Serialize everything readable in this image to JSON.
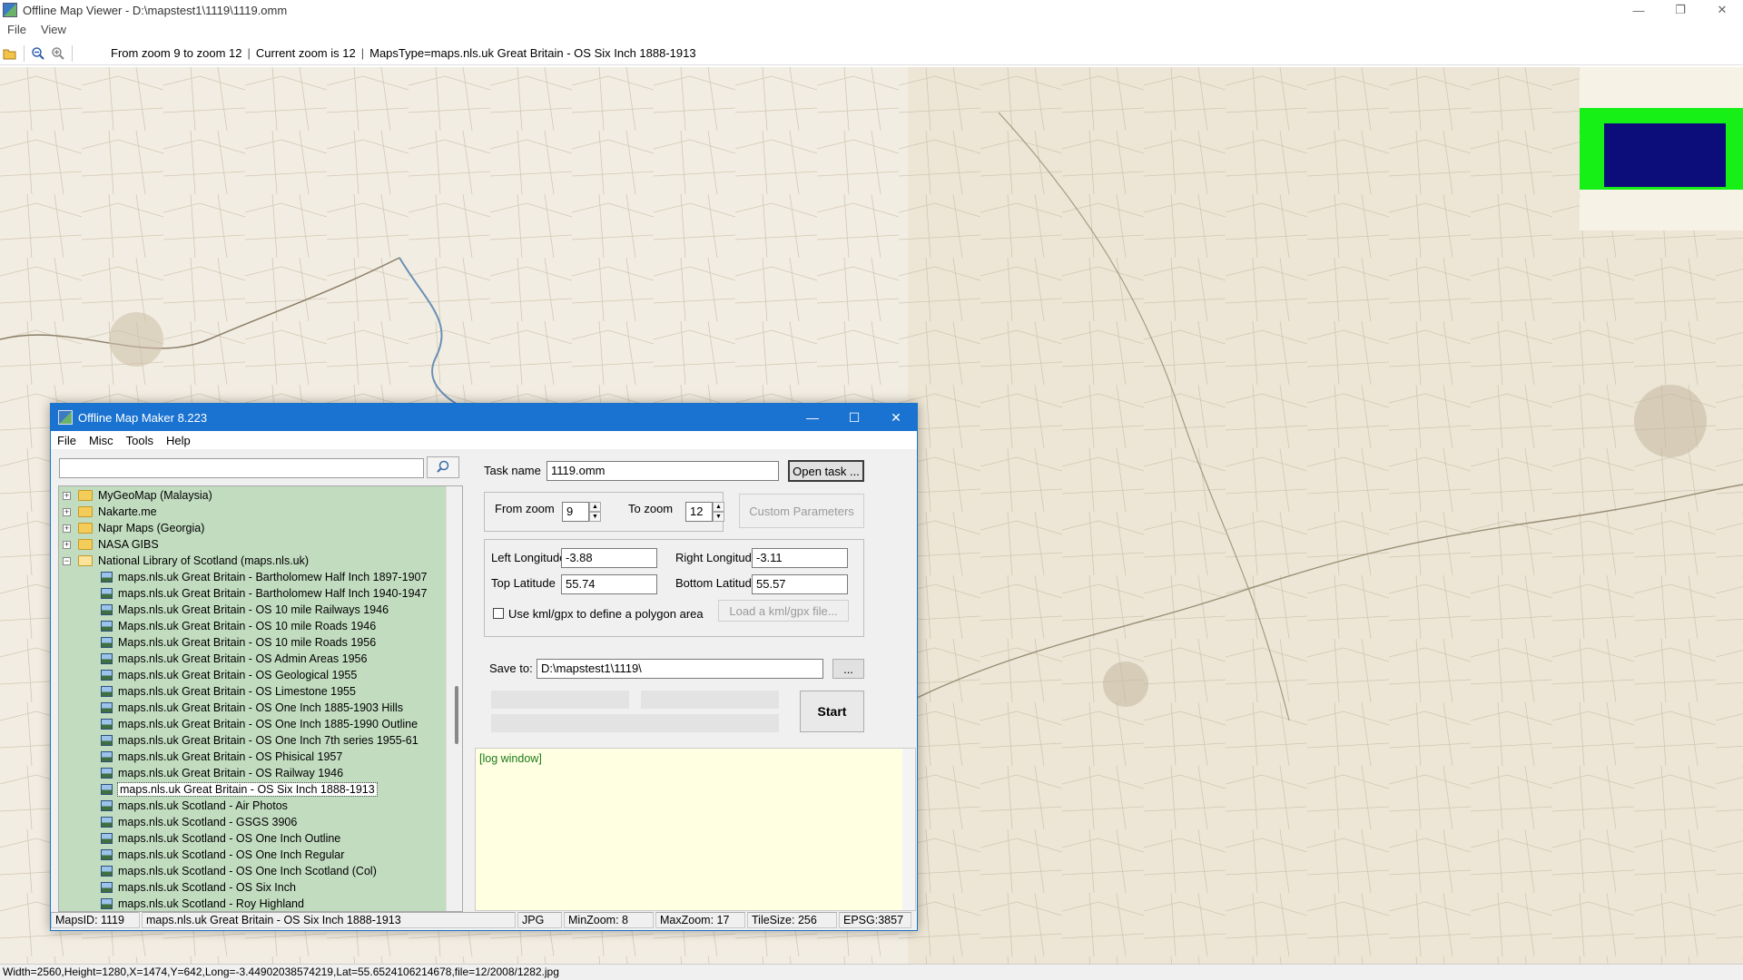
{
  "window": {
    "title": "Offline Map Viewer - D:\\mapstest1\\1119\\1119.omm",
    "controls": {
      "minimize": "—",
      "maximize": "❐",
      "close": "✕"
    }
  },
  "menubar": {
    "items": [
      "File",
      "View"
    ]
  },
  "toolbar": {
    "icons": [
      "open-folder-icon",
      "zoom-out-icon",
      "zoom-in-icon"
    ],
    "zoom_range": "From zoom 9 to zoom 12",
    "current_zoom": "Current zoom is 12",
    "maps_type": "MapsType=maps.nls.uk Great Britain - OS Six Inch 1888-1913",
    "separator": "|"
  },
  "map": {
    "minimap_frame_color": "#16f016",
    "minimap_view_color": "#0c0c7a",
    "background": "#ede6d6"
  },
  "statusbar": {
    "text": "Width=2560,Height=1280,X=1474,Y=642,Long=-3.44902038574219,Lat=55.6524106214678,file=12/2008/1282.jpg"
  },
  "dialog": {
    "title": "Offline Map Maker 8.223",
    "controls": {
      "minimize": "—",
      "maximize": "☐",
      "close": "✕"
    },
    "menu": [
      "File",
      "Misc",
      "Tools",
      "Help"
    ],
    "search": {
      "value": "",
      "placeholder": ""
    },
    "tree": {
      "folders": [
        {
          "label": "MyGeoMap (Malaysia)",
          "expanded": false
        },
        {
          "label": "Nakarte.me",
          "expanded": false
        },
        {
          "label": "Napr Maps (Georgia)",
          "expanded": false
        },
        {
          "label": "NASA GIBS",
          "expanded": false
        },
        {
          "label": "National Library of Scotland (maps.nls.uk)",
          "expanded": true
        }
      ],
      "items": [
        "maps.nls.uk Great Britain - Bartholomew Half Inch 1897-1907",
        "maps.nls.uk Great Britain - Bartholomew Half Inch 1940-1947",
        "Maps.nls.uk Great Britain - OS 10 mile Railways 1946",
        "Maps.nls.uk Great Britain - OS 10 mile Roads 1946",
        "Maps.nls.uk Great Britain - OS 10 mile Roads 1956",
        "maps.nls.uk Great Britain - OS Admin Areas 1956",
        "maps.nls.uk Great Britain - OS Geological 1955",
        "maps.nls.uk Great Britain - OS Limestone 1955",
        "maps.nls.uk Great Britain - OS One Inch 1885-1903 Hills",
        "maps.nls.uk Great Britain - OS One Inch 1885-1990 Outline",
        "maps.nls.uk Great Britain - OS One Inch 7th series 1955-61",
        "maps.nls.uk Great Britain - OS Phisical 1957",
        "maps.nls.uk Great Britain - OS Railway 1946",
        "maps.nls.uk Great Britain - OS Six Inch 1888-1913",
        "maps.nls.uk Scotland - Air Photos",
        "maps.nls.uk Scotland - GSGS 3906",
        "maps.nls.uk Scotland - OS One Inch Outline",
        "maps.nls.uk Scotland - OS One Inch Regular",
        "maps.nls.uk Scotland - OS One Inch Scotland (Col)",
        "maps.nls.uk Scotland - OS Six Inch",
        "maps.nls.uk Scotland - Roy Highland"
      ],
      "selected_item": "maps.nls.uk Great Britain - OS Six Inch 1888-1913"
    },
    "task": {
      "label": "Task name",
      "value": "1119.omm",
      "open_button": "Open task ..."
    },
    "zoom": {
      "from_label": "From zoom",
      "from_value": "9",
      "to_label": "To zoom",
      "to_value": "12",
      "custom_button": "Custom Parameters"
    },
    "coords": {
      "left_lon_label": "Left Longitude",
      "left_lon": "-3.88",
      "right_lon_label": "Right Longitude",
      "right_lon": "-3.11",
      "top_lat_label": "Top Latitude",
      "top_lat": "55.74",
      "bottom_lat_label": "Bottom Latitude",
      "bottom_lat": "55.57",
      "kml_label": "Use kml/gpx to define a polygon area",
      "kml_checked": false,
      "load_kml_button": "Load a kml/gpx file..."
    },
    "save": {
      "label": "Save to:",
      "value": "D:\\mapstest1\\1119\\",
      "browse_button": "..."
    },
    "start_button": "Start",
    "log": {
      "text": "[log window]"
    },
    "status": {
      "maps_id": "MapsID: 1119",
      "map_name": "maps.nls.uk Great Britain - OS Six Inch 1888-1913",
      "format": "JPG",
      "min_zoom": "MinZoom: 8",
      "max_zoom": "MaxZoom: 17",
      "tile_size": "TileSize: 256",
      "epsg": "EPSG:3857"
    }
  }
}
